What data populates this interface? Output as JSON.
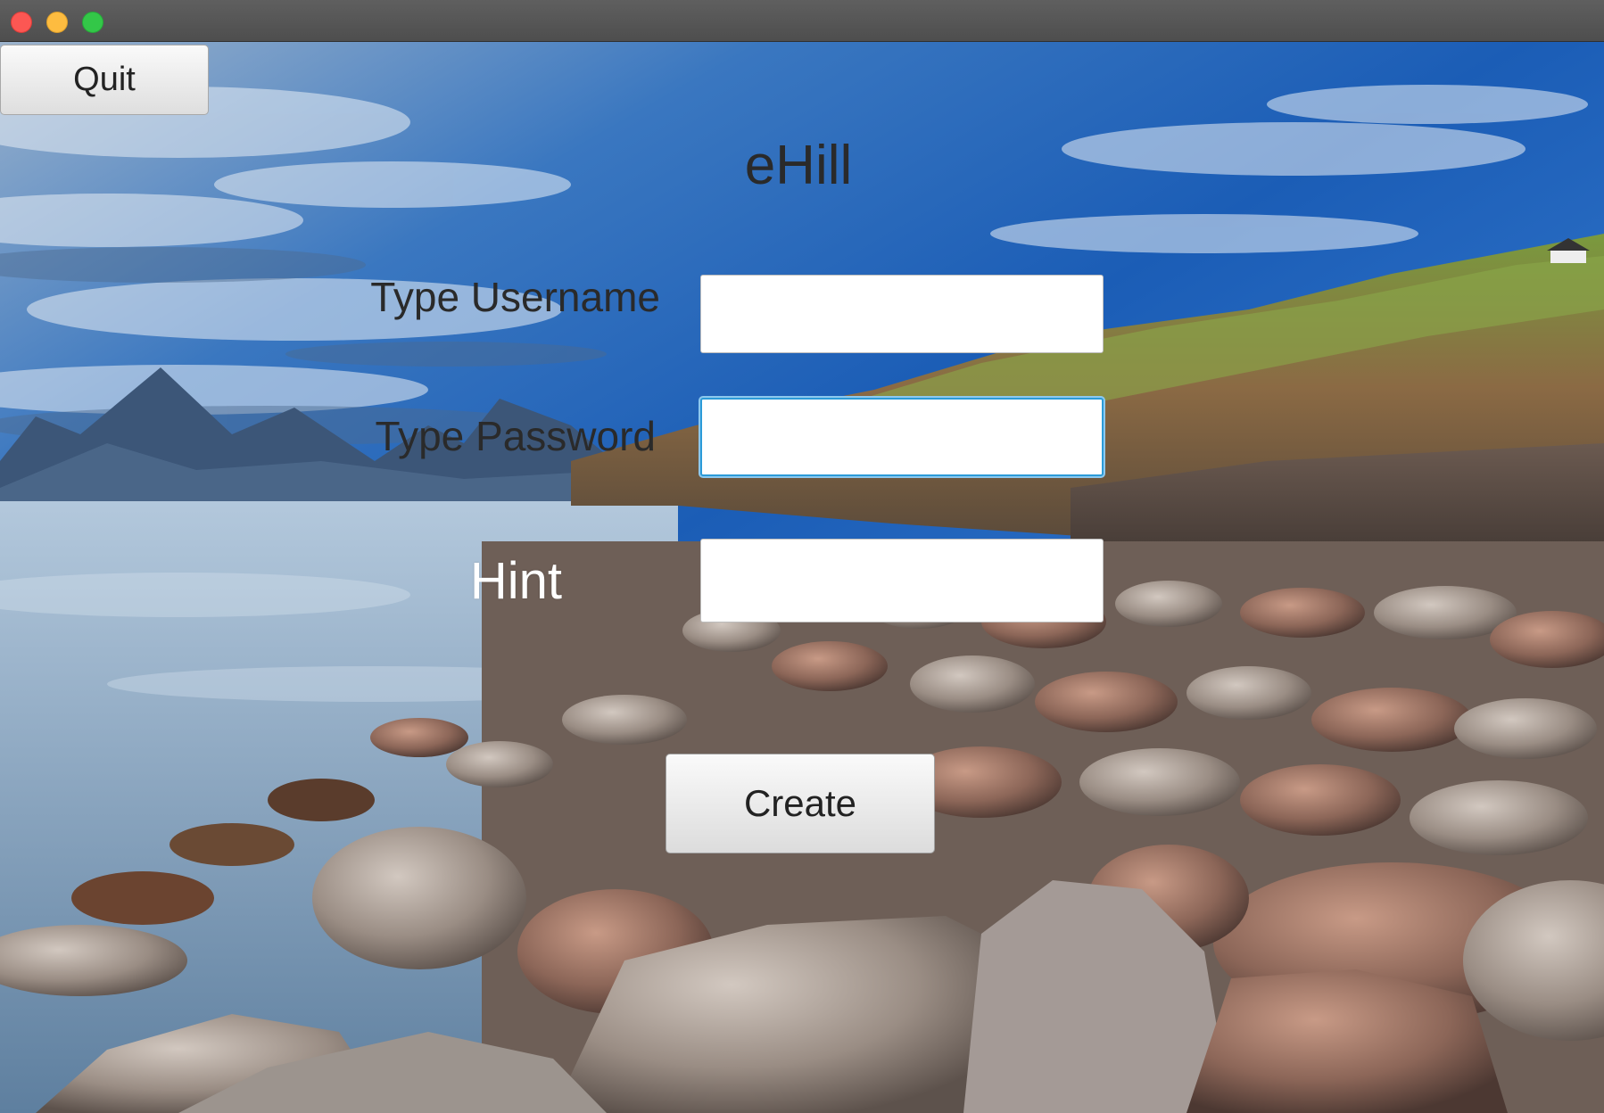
{
  "window": {
    "traffic_lights": [
      "close",
      "minimize",
      "zoom"
    ]
  },
  "toolbar": {
    "quit_label": "Quit"
  },
  "app": {
    "title": "eHill"
  },
  "form": {
    "username_label": "Type Username",
    "username_value": "",
    "password_label": "Type Password",
    "password_value": "",
    "hint_label": "Hint",
    "hint_value": "",
    "create_label": "Create"
  },
  "colors": {
    "focus_ring": "#2c9bd8",
    "sky": "#1d5fb0",
    "hill": "#6e8a3a",
    "water": "#8fb0d0",
    "rocks": "#8a7a6e"
  }
}
